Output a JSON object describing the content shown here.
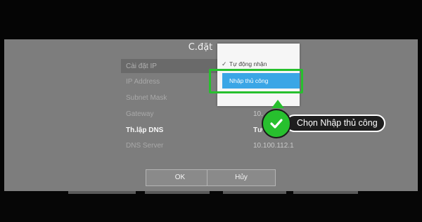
{
  "dialog": {
    "title": "C.đặt"
  },
  "settings": {
    "rows": [
      {
        "label": "Cài đặt IP",
        "value": ""
      },
      {
        "label": "IP Address",
        "value": ""
      },
      {
        "label": "Subnet Mask",
        "value": ""
      },
      {
        "label": "Gateway",
        "value": "10."
      },
      {
        "label": "Th.lập DNS",
        "value": "Tư"
      },
      {
        "label": "DNS Server",
        "value": "10.100.112.1"
      }
    ]
  },
  "dropdown": {
    "options": [
      {
        "label": "Tự động nhận",
        "checked": true
      },
      {
        "label": "Nhập thủ công",
        "selected": true
      }
    ]
  },
  "buttons": {
    "ok": "OK",
    "cancel": "Hủy"
  },
  "callout": {
    "text": "Chọn Nhập thủ công",
    "icon": "checkmark-icon",
    "color": "#27c02e"
  },
  "colors": {
    "dialog_bg": "#7d7d7d",
    "selection": "#3aa6e6",
    "highlight_border": "#27c02e"
  }
}
